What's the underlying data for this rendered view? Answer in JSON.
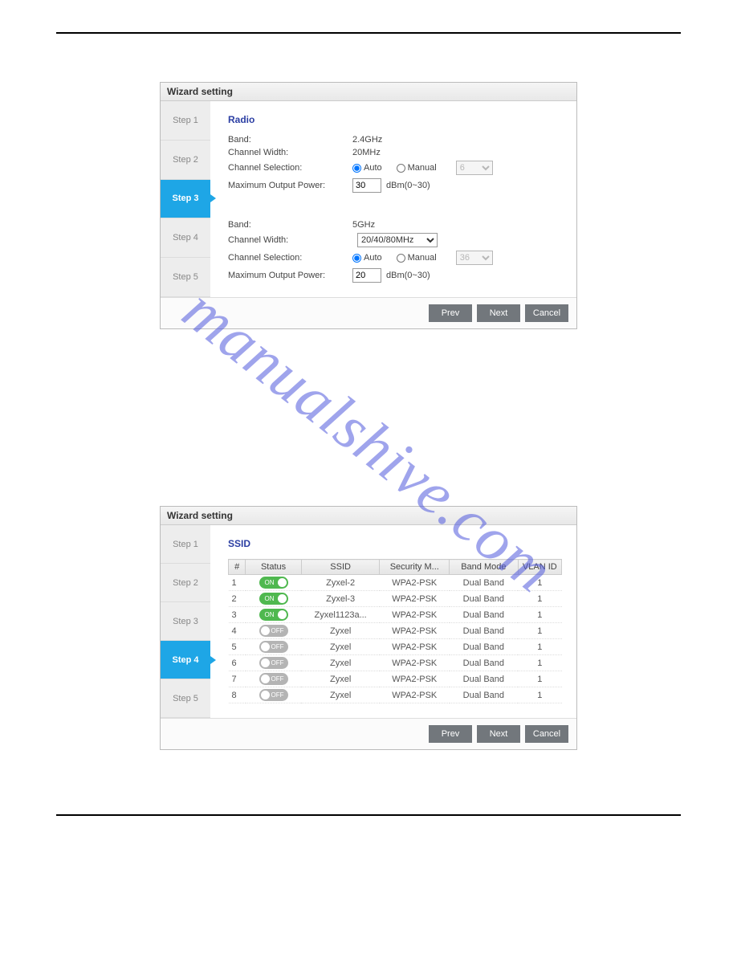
{
  "watermark": "manualshive.com",
  "panel1": {
    "title": "Wizard setting",
    "steps": [
      "Step 1",
      "Step 2",
      "Step 3",
      "Step 4",
      "Step 5"
    ],
    "active_index": 2,
    "heading": "Radio",
    "band1": {
      "band_label": "Band:",
      "band_value": "2.4GHz",
      "cw_label": "Channel Width:",
      "cw_value": "20MHz",
      "cs_label": "Channel Selection:",
      "cs_auto": "Auto",
      "cs_manual": "Manual",
      "cs_disabled_sel": "6",
      "power_label": "Maximum Output Power:",
      "power_value": "30",
      "power_unit": "dBm(0~30)"
    },
    "band2": {
      "band_label": "Band:",
      "band_value": "5GHz",
      "cw_label": "Channel Width:",
      "cw_value": "20/40/80MHz",
      "cs_label": "Channel Selection:",
      "cs_auto": "Auto",
      "cs_manual": "Manual",
      "cs_disabled_sel": "36",
      "power_label": "Maximum Output Power:",
      "power_value": "20",
      "power_unit": "dBm(0~30)"
    },
    "buttons": {
      "prev": "Prev",
      "next": "Next",
      "cancel": "Cancel"
    }
  },
  "panel2": {
    "title": "Wizard setting",
    "steps": [
      "Step 1",
      "Step 2",
      "Step 3",
      "Step 4",
      "Step 5"
    ],
    "active_index": 3,
    "heading": "SSID",
    "columns": [
      "#",
      "Status",
      "SSID",
      "Security M...",
      "Band Mode",
      "VLAN ID"
    ],
    "rows": [
      {
        "n": "1",
        "status": "ON",
        "ssid": "Zyxel-2",
        "sec": "WPA2-PSK",
        "band": "Dual Band",
        "vlan": "1"
      },
      {
        "n": "2",
        "status": "ON",
        "ssid": "Zyxel-3",
        "sec": "WPA2-PSK",
        "band": "Dual Band",
        "vlan": "1"
      },
      {
        "n": "3",
        "status": "ON",
        "ssid": "Zyxel1123a...",
        "sec": "WPA2-PSK",
        "band": "Dual Band",
        "vlan": "1"
      },
      {
        "n": "4",
        "status": "OFF",
        "ssid": "Zyxel",
        "sec": "WPA2-PSK",
        "band": "Dual Band",
        "vlan": "1"
      },
      {
        "n": "5",
        "status": "OFF",
        "ssid": "Zyxel",
        "sec": "WPA2-PSK",
        "band": "Dual Band",
        "vlan": "1"
      },
      {
        "n": "6",
        "status": "OFF",
        "ssid": "Zyxel",
        "sec": "WPA2-PSK",
        "band": "Dual Band",
        "vlan": "1"
      },
      {
        "n": "7",
        "status": "OFF",
        "ssid": "Zyxel",
        "sec": "WPA2-PSK",
        "band": "Dual Band",
        "vlan": "1"
      },
      {
        "n": "8",
        "status": "OFF",
        "ssid": "Zyxel",
        "sec": "WPA2-PSK",
        "band": "Dual Band",
        "vlan": "1"
      }
    ],
    "buttons": {
      "prev": "Prev",
      "next": "Next",
      "cancel": "Cancel"
    }
  }
}
